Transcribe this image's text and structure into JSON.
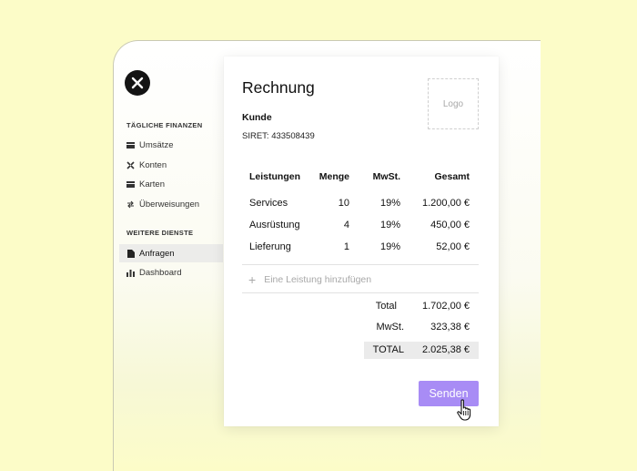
{
  "sidebar": {
    "sections": [
      {
        "label": "TÄGLICHE FINANZEN",
        "items": [
          {
            "label": "Umsätze",
            "icon": "card-icon"
          },
          {
            "label": "Konten",
            "icon": "cross-icon"
          },
          {
            "label": "Karten",
            "icon": "card-icon"
          },
          {
            "label": "Überweisungen",
            "icon": "transfer-icon"
          }
        ]
      },
      {
        "label": "WEITERE DIENSTE",
        "items": [
          {
            "label": "Anfragen",
            "icon": "document-icon",
            "active": true
          },
          {
            "label": "Dashboard",
            "icon": "bar-chart-icon"
          }
        ]
      }
    ]
  },
  "invoice": {
    "title": "Rechnung",
    "logo_placeholder": "Logo",
    "client_label": "Kunde",
    "siret": "SIRET: 433508439",
    "columns": [
      "Leistungen",
      "Menge",
      "MwSt.",
      "Gesamt"
    ],
    "rows": [
      {
        "service": "Services",
        "qty": "10",
        "vat": "19%",
        "total": "1.200,00 €"
      },
      {
        "service": "Ausrüstung",
        "qty": "4",
        "vat": "19%",
        "total": "450,00 €"
      },
      {
        "service": "Lieferung",
        "qty": "1",
        "vat": "19%",
        "total": "52,00 €"
      }
    ],
    "add_service": "Eine Leistung hinzufügen",
    "summary": {
      "subtotal_label": "Total",
      "subtotal": "1.702,00 €",
      "vat_label": "MwSt.",
      "vat": "323,38 €",
      "total_label": "TOTAL",
      "total": "2.025,38 €"
    },
    "send_label": "Senden"
  },
  "colors": {
    "background": "#fcfcc8",
    "accent": "#a88cf5"
  }
}
